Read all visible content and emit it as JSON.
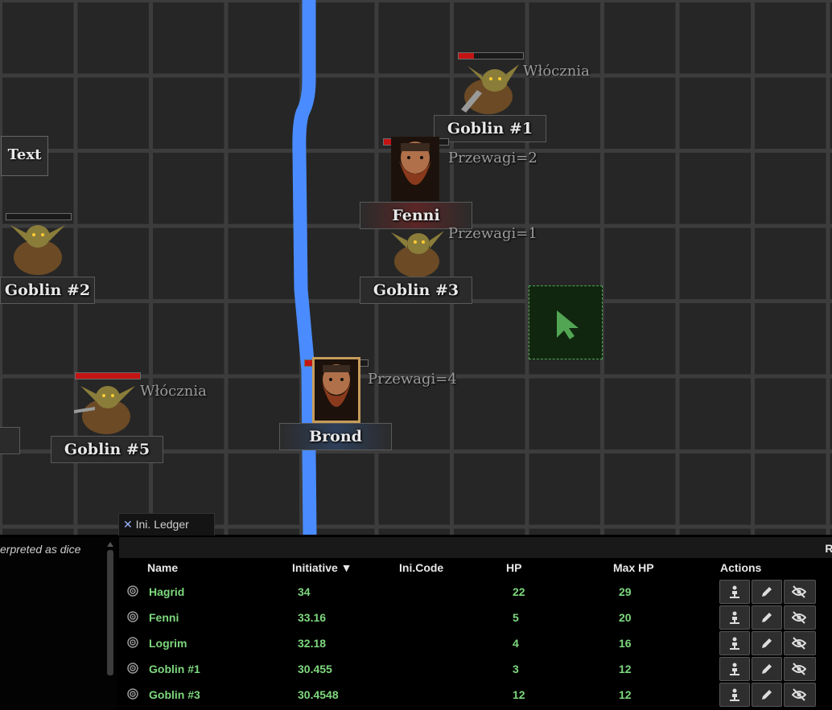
{
  "map": {
    "tokens": [
      {
        "id": "goblin1",
        "name": "Goblin #1",
        "tag": "Włócznia",
        "hp_fraction": 0.3
      },
      {
        "id": "fenni",
        "name": "Fenni",
        "tag": "Przewagi=2",
        "hp_fraction": 0.3
      },
      {
        "id": "goblin3",
        "name": "Goblin #3",
        "tag": "Przewagi=1"
      },
      {
        "id": "goblin2",
        "name": "Goblin #2",
        "hp_fraction": 0
      },
      {
        "id": "goblin5",
        "name": "Goblin #5",
        "tag": "Włócznia",
        "hp_fraction": 1.0
      },
      {
        "id": "brond",
        "name": "Brond",
        "tag": "Przewagi=4",
        "hp_fraction": 0.65
      }
    ],
    "text_token": "Text",
    "cursor_tile_icon": "cursor-arrow-icon"
  },
  "left_panel": {
    "hint": "erpreted as dice"
  },
  "tab": {
    "close_symbol": "✕",
    "label": "Ini. Ledger"
  },
  "ledger": {
    "top_right": "Ro",
    "headers": {
      "name": "Name",
      "initiative": "Initiative ▼",
      "ini_code": "Ini.Code",
      "hp": "HP",
      "max_hp": "Max HP",
      "actions": "Actions"
    },
    "rows": [
      {
        "name": "Hagrid",
        "initiative": "34",
        "ini_code": "",
        "hp": "22",
        "max_hp": "29"
      },
      {
        "name": "Fenni",
        "initiative": "33.16",
        "ini_code": "",
        "hp": "5",
        "max_hp": "20"
      },
      {
        "name": "Logrim",
        "initiative": "32.18",
        "ini_code": "",
        "hp": "4",
        "max_hp": "16"
      },
      {
        "name": "Goblin #1",
        "initiative": "30.455",
        "ini_code": "",
        "hp": "3",
        "max_hp": "12"
      },
      {
        "name": "Goblin #3",
        "initiative": "30.4548",
        "ini_code": "",
        "hp": "12",
        "max_hp": "12"
      }
    ],
    "action_icons": [
      "select-token-icon",
      "edit-icon",
      "hide-icon"
    ]
  },
  "colors": {
    "path": "#4a8cff",
    "text_green": "#7ed87e",
    "hp_red": "#c41414",
    "cursor_tile": "#52a552"
  }
}
